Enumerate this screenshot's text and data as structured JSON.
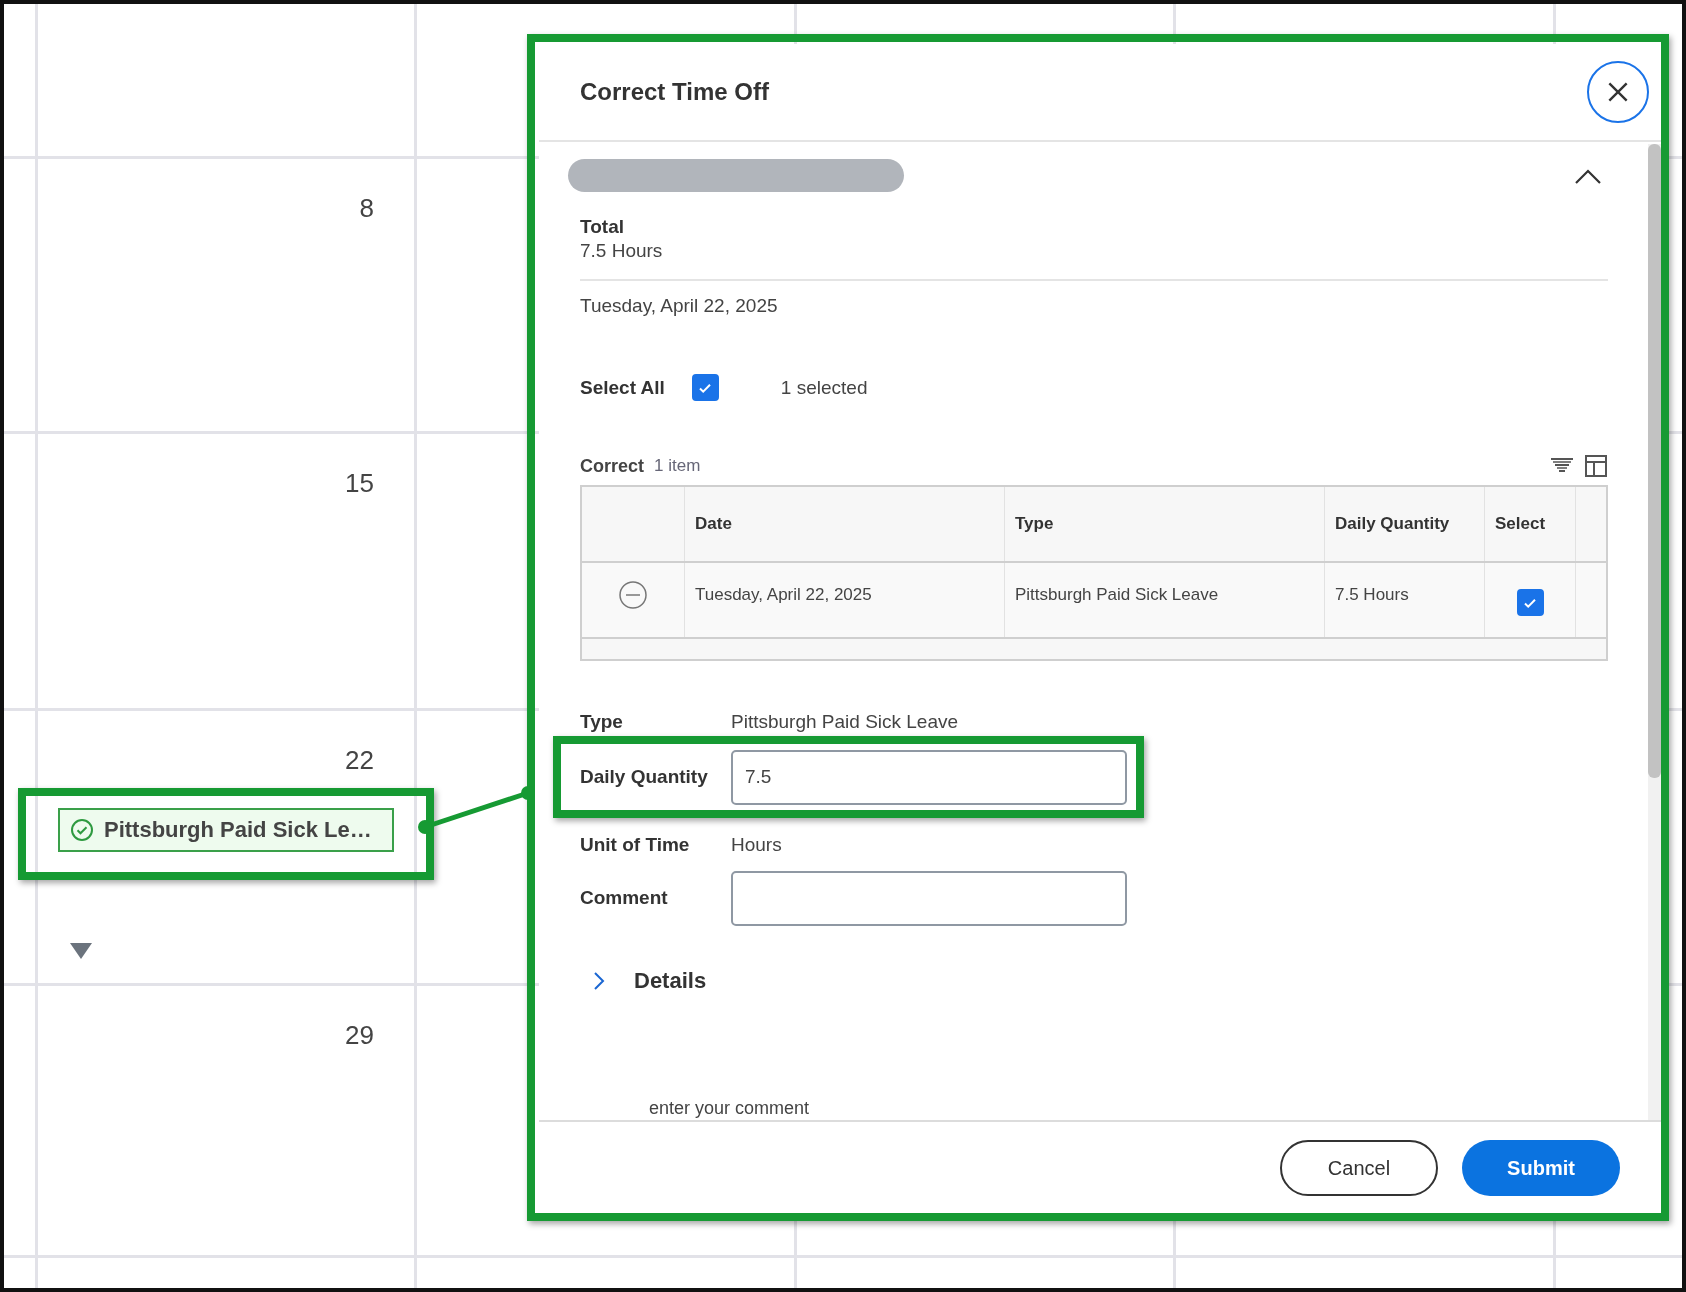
{
  "calendar": {
    "day_numbers": [
      "8",
      "15",
      "22",
      "29"
    ],
    "event": {
      "label": "Pittsburgh Paid Sick Le…",
      "highlighted": true
    }
  },
  "dialog": {
    "title": "Correct Time Off",
    "highlighted": true,
    "section": {
      "expanded": true,
      "total_label": "Total",
      "total_value": "7.5 Hours",
      "date_heading": "Tuesday, April 22, 2025",
      "select_all": {
        "label": "Select All",
        "checked": true
      },
      "selected_count": "1 selected",
      "table": {
        "title": "Correct",
        "count": "1 item",
        "columns": [
          "Date",
          "Type",
          "Daily Quantity",
          "Select"
        ],
        "rows": [
          {
            "cells": [
              "Tuesday, April 22, 2025",
              "Pittsburgh Paid Sick Leave",
              "7.5 Hours"
            ],
            "selected": true
          }
        ]
      }
    },
    "fields": [
      {
        "kind": "text",
        "label": "Type",
        "value": "Pittsburgh Paid Sick Leave",
        "highlighted": false
      },
      {
        "kind": "input",
        "label": "Daily Quantity",
        "value": "7.5",
        "highlighted": true
      },
      {
        "kind": "text",
        "label": "Unit of Time",
        "value": "Hours",
        "highlighted": false
      },
      {
        "kind": "input",
        "label": "Comment",
        "highlighted": false
      }
    ],
    "details": {
      "label": "Details",
      "expanded": false
    },
    "comment_hint": "enter your comment",
    "buttons": [
      {
        "label": "Cancel",
        "kind": "secondary"
      },
      {
        "label": "Submit",
        "kind": "primary"
      }
    ]
  }
}
